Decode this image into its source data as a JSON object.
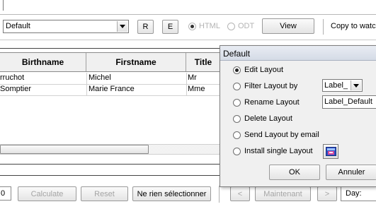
{
  "toolbar": {
    "layout_select_value": "Default",
    "r_button": "R",
    "e_button": "E",
    "html_label": "HTML",
    "odt_label": "ODT",
    "view_button": "View",
    "copy_label": "Copy to watc"
  },
  "table": {
    "columns": [
      "Birthname",
      "Firstname",
      "Title"
    ],
    "rows": [
      [
        "rruchot",
        "Michel",
        "Mr"
      ],
      [
        "Somptier",
        "Marie France",
        "Mme"
      ]
    ]
  },
  "bottom": {
    "number_value": "0",
    "calculate_button": "Calculate",
    "reset_button": "Reset",
    "select_none_button": "Ne rien sélectionner",
    "prev_button": "<",
    "now_button": "Maintenant",
    "next_button": ">",
    "day_label": "Day:"
  },
  "popup": {
    "title": "Default",
    "options": [
      "Edit Layout",
      "Filter Layout by",
      "Rename Layout",
      "Delete Layout",
      "Send Layout by email",
      "Install single Layout"
    ],
    "selected_option": "Edit Layout",
    "filter_select_value": "Label_",
    "rename_field_value": "Label_Default",
    "ok_button": "OK",
    "cancel_button": "Annuler"
  }
}
